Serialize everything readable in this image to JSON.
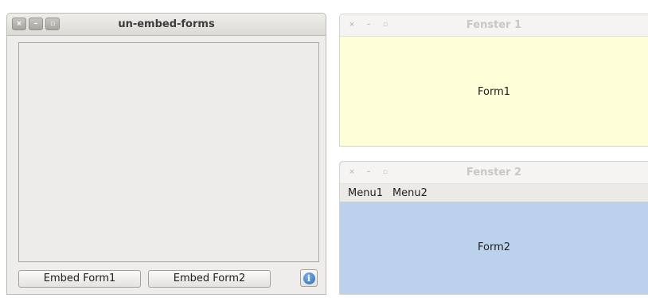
{
  "main_window": {
    "title": "un-embed-forms",
    "close_glyph": "×",
    "minimize_glyph": "–",
    "maximize_glyph": "▫",
    "embed_form1_label": "Embed Form1",
    "embed_form2_label": "Embed Form2",
    "info_icon": "info-icon",
    "info_glyph": "i"
  },
  "window1": {
    "title": "Fenster 1",
    "close_glyph": "×",
    "minimize_glyph": "–",
    "maximize_glyph": "▫",
    "form_label": "Form1",
    "background": "#fefed8"
  },
  "window2": {
    "title": "Fenster 2",
    "close_glyph": "×",
    "minimize_glyph": "–",
    "maximize_glyph": "▫",
    "menu": [
      "Menu1",
      "Menu2"
    ],
    "form_label": "Form2",
    "background": "#bcd2ec"
  }
}
